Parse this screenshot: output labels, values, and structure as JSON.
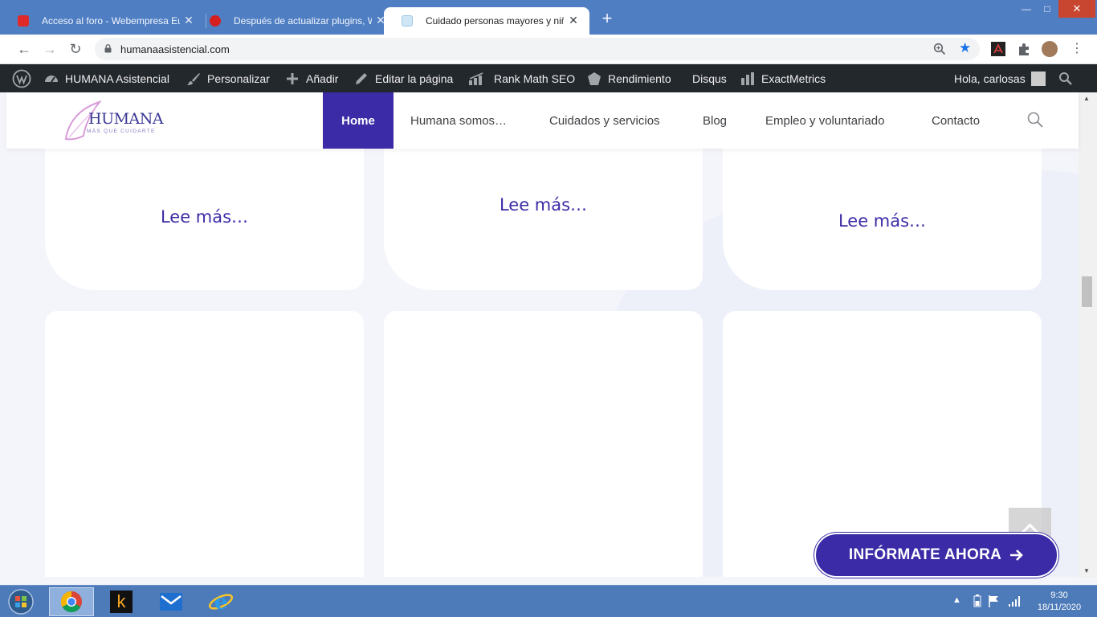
{
  "browser": {
    "tabs": [
      {
        "title": "Acceso al foro - Webempresa Eu",
        "favicon": "webempresa-icon",
        "active": false
      },
      {
        "title": "Después de actualizar plugins, W",
        "favicon": "webempresa-round-icon",
        "active": false
      },
      {
        "title": "Cuidado personas mayores y niño",
        "favicon": "humana-icon",
        "active": true
      }
    ],
    "new_tab": "+",
    "url": "humanaasistencial.com"
  },
  "adminbar": {
    "items": [
      {
        "label": "HUMANA Asistencial",
        "icon": "dashboard-icon"
      },
      {
        "label": "Personalizar",
        "icon": "brush-icon"
      },
      {
        "label": "Añadir",
        "icon": "plus-icon"
      },
      {
        "label": "Editar la página",
        "icon": "pencil-icon"
      },
      {
        "label": "Rank Math SEO",
        "icon": "rankmath-icon"
      },
      {
        "label": "Rendimiento",
        "icon": "performance-icon"
      },
      {
        "label": "Disqus",
        "icon": ""
      },
      {
        "label": "ExactMetrics",
        "icon": "bars-icon"
      }
    ],
    "greeting": "Hola, carlosas"
  },
  "site": {
    "logo_text": "HUMANA",
    "logo_tagline": "MÁS QUE CUIDARTE",
    "nav": [
      {
        "label": "Home",
        "active": true
      },
      {
        "label": "Humana somos…",
        "active": false
      },
      {
        "label": "Cuidados y servicios",
        "active": false
      },
      {
        "label": "Blog",
        "active": false
      },
      {
        "label": "Empleo y voluntariado",
        "active": false
      },
      {
        "label": "Contacto",
        "active": false
      }
    ]
  },
  "cards": {
    "read_more": [
      "Lee más…",
      "Lee más…",
      "Lee más…"
    ]
  },
  "cta": {
    "label": "INFÓRMATE AHORA"
  },
  "taskbar": {
    "time": "9:30",
    "date": "18/11/2020"
  },
  "colors": {
    "brand": "#3b2ba6",
    "chrome_frame": "#4f7ec2",
    "adminbar": "#23282d",
    "taskbar": "#4d7ab8"
  }
}
